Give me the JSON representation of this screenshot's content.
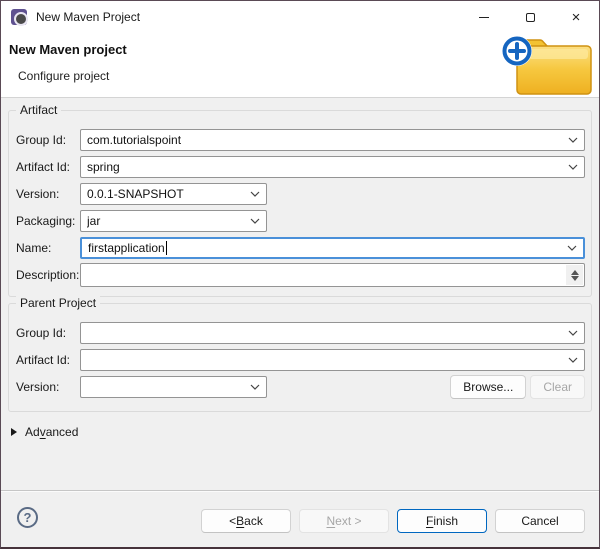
{
  "titlebar": {
    "title": "New Maven Project"
  },
  "banner": {
    "title": "New Maven project",
    "subtitle": "Configure project"
  },
  "artifact": {
    "legend": "Artifact",
    "group_id_label": "Group Id:",
    "group_id_value": "com.tutorialspoint",
    "artifact_id_label": "Artifact Id:",
    "artifact_id_value": "spring",
    "version_label": "Version:",
    "version_value": "0.0.1-SNAPSHOT",
    "packaging_label": "Packaging:",
    "packaging_value": "jar",
    "name_label": "Name:",
    "name_value": "firstapplication",
    "description_label": "Description:",
    "description_value": ""
  },
  "parent": {
    "legend": "Parent Project",
    "group_id_label": "Group Id:",
    "group_id_value": "",
    "artifact_id_label": "Artifact Id:",
    "artifact_id_value": "",
    "version_label": "Version:",
    "version_value": "",
    "browse_label": "Browse...",
    "clear_label": "Clear"
  },
  "advanced": {
    "pre": "Ad",
    "key": "v",
    "post": "anced"
  },
  "footer": {
    "help": "?",
    "back_pre": "< ",
    "back_key": "B",
    "back_post": "ack",
    "next_key": "N",
    "next_post": "ext >",
    "finish_key": "F",
    "finish_post": "inish",
    "cancel": "Cancel"
  },
  "colors": {
    "default_button_border": "#0067c0",
    "focus_border": "#4a90d9",
    "folder_yellow": "#f5c53c",
    "badge_blue": "#1565c0",
    "content_bg": "#f0f0f0"
  }
}
